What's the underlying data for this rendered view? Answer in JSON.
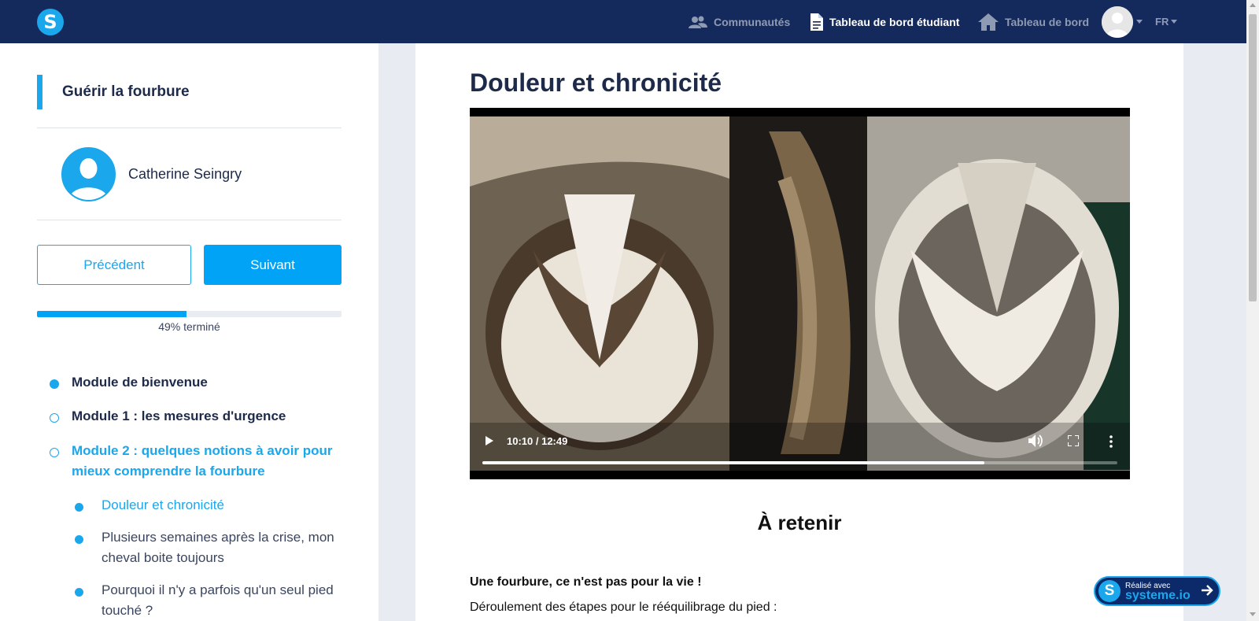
{
  "brand": {
    "logo_letter": "S",
    "accent": "#1aa7ec",
    "nav_bg": "#152a5c"
  },
  "topnav": {
    "communities": "Communautés",
    "student_dashboard": "Tableau de bord étudiant",
    "dashboard": "Tableau de bord",
    "language": "FR"
  },
  "sidebar": {
    "course_title": "Guérir la fourbure",
    "author": "Catherine Seingry",
    "prev_label": "Précédent",
    "next_label": "Suivant",
    "progress_percent": 49,
    "progress_label": "49% terminé",
    "modules": [
      {
        "label": "Module de bienvenue",
        "state": "completed"
      },
      {
        "label": "Module 1 : les mesures d'urgence",
        "state": "open"
      },
      {
        "label": "Module 2 : quelques notions à avoir pour mieux comprendre la fourbure",
        "state": "active"
      }
    ],
    "lessons": [
      {
        "label": "Douleur et chronicité",
        "active": true
      },
      {
        "label": "Plusieurs semaines après la crise, mon cheval boite toujours",
        "active": false
      },
      {
        "label": "Pourquoi il n'y a parfois qu'un seul pied touché ?",
        "active": false
      }
    ]
  },
  "main": {
    "lesson_title": "Douleur et chronicité",
    "video": {
      "time": "10:10 / 12:49",
      "played_fraction": 0.79
    },
    "section_heading": "À retenir",
    "bold_paragraph": "Une fourbure, ce n'est pas pour la vie !",
    "partial_paragraph": "Déroulement des étapes pour le rééquilibrage du pied :"
  },
  "badge": {
    "small": "Réalisé avec",
    "big": "systeme.io"
  }
}
